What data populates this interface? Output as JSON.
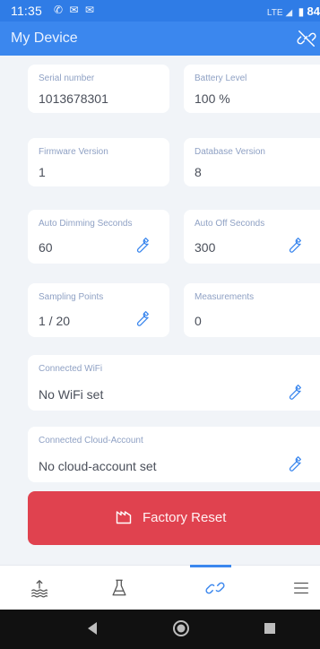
{
  "status_bar": {
    "time": "11:35",
    "notification_icons": [
      "whatsapp-icon",
      "message-icon",
      "message-icon"
    ],
    "network": "LTE",
    "battery": "84"
  },
  "app_bar": {
    "title": "My Device",
    "action_icon": "link-off-icon"
  },
  "cards": [
    {
      "label": "Serial number",
      "value": "1013678301",
      "editable": false
    },
    {
      "label": "Battery Level",
      "value": "100 %",
      "editable": false
    },
    {
      "label": "Firmware Version",
      "value": "1",
      "editable": false
    },
    {
      "label": "Database Version",
      "value": "8",
      "editable": false
    },
    {
      "label": "Auto Dimming Seconds",
      "value": "60",
      "editable": true
    },
    {
      "label": "Auto Off Seconds",
      "value": "300",
      "editable": true
    },
    {
      "label": "Sampling Points",
      "value": "1 / 20",
      "editable": true
    },
    {
      "label": "Measurements",
      "value": "0",
      "editable": false
    },
    {
      "label": "Connected WiFi",
      "value": "No WiFi set",
      "editable": true
    },
    {
      "label": "Connected Cloud-Account",
      "value": "No cloud-account set",
      "editable": true
    }
  ],
  "factory_reset": {
    "label": "Factory Reset"
  },
  "tabs": [
    {
      "icon": "water-level-icon",
      "active": false
    },
    {
      "icon": "flask-icon",
      "active": false
    },
    {
      "icon": "link-icon",
      "active": true
    },
    {
      "icon": "menu-icon",
      "active": false
    }
  ],
  "colors": {
    "primary": "#3b87ee",
    "status_bar": "#2f7ce6",
    "danger": "#e0424f",
    "background": "#f1f4f8",
    "label": "#8fa1c4"
  }
}
